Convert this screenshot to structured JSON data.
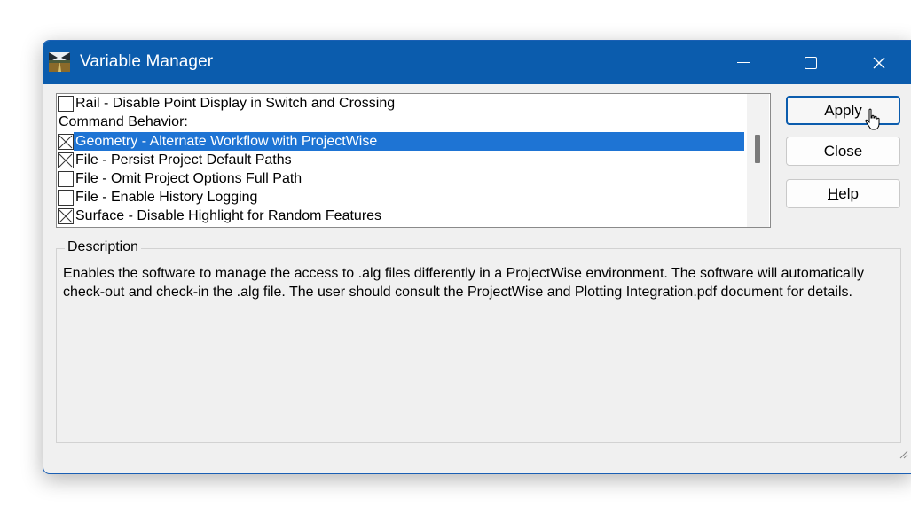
{
  "window": {
    "title": "Variable Manager",
    "controls": {
      "minimize": "minimize",
      "maximize": "maximize",
      "close": "close"
    }
  },
  "list": {
    "items": [
      {
        "label": "Rail - Disable Point Display in Switch and Crossing",
        "type": "checkbox",
        "checked": false,
        "selected": false
      },
      {
        "label": "Command Behavior:",
        "type": "header",
        "checked": false,
        "selected": false
      },
      {
        "label": "Geometry - Alternate Workflow with ProjectWise",
        "type": "checkbox",
        "checked": true,
        "selected": true
      },
      {
        "label": "File - Persist Project Default Paths",
        "type": "checkbox",
        "checked": true,
        "selected": false
      },
      {
        "label": "File - Omit Project Options Full Path",
        "type": "checkbox",
        "checked": false,
        "selected": false
      },
      {
        "label": "File - Enable History Logging",
        "type": "checkbox",
        "checked": false,
        "selected": false
      },
      {
        "label": "Surface - Disable Highlight for Random Features",
        "type": "checkbox",
        "checked": true,
        "selected": false
      }
    ]
  },
  "buttons": {
    "apply": "Apply",
    "close": "Close",
    "help_mnemonic": "H",
    "help_rest": "elp"
  },
  "description": {
    "label": "Description",
    "text": "Enables the software to manage the access to .alg files differently in a ProjectWise environment.  The software will automatically check-out and check-in the .alg file.  The user should consult the ProjectWise and Plotting Integration.pdf document for details."
  },
  "colors": {
    "titlebar": "#0b5cad",
    "selection": "#1e74d4",
    "default_button_border": "#0b5cad"
  }
}
